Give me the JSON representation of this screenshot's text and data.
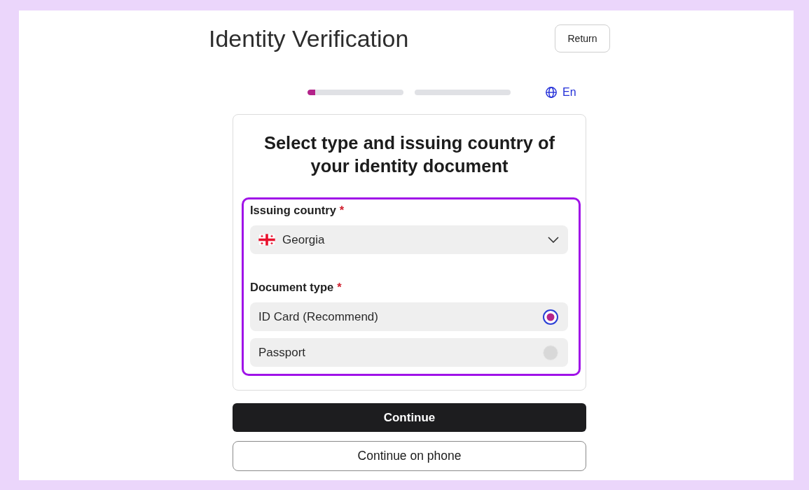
{
  "header": {
    "title": "Identity Verification",
    "return_button": "Return"
  },
  "progress": {
    "level": 0.08,
    "language": "En"
  },
  "card": {
    "heading": "Select type and issuing country of your identity document",
    "issuing_country": {
      "label": "Issuing country",
      "required_mark": "*",
      "value": "Georgia"
    },
    "document_type": {
      "label": "Document type",
      "required_mark": "*",
      "options": [
        {
          "label": "ID Card (Recommend)",
          "selected": true
        },
        {
          "label": "Passport",
          "selected": false
        }
      ]
    }
  },
  "buttons": [
    {
      "label": "Continue",
      "kind": "primary"
    },
    {
      "label": "Continue on phone",
      "kind": "secondary"
    }
  ]
}
